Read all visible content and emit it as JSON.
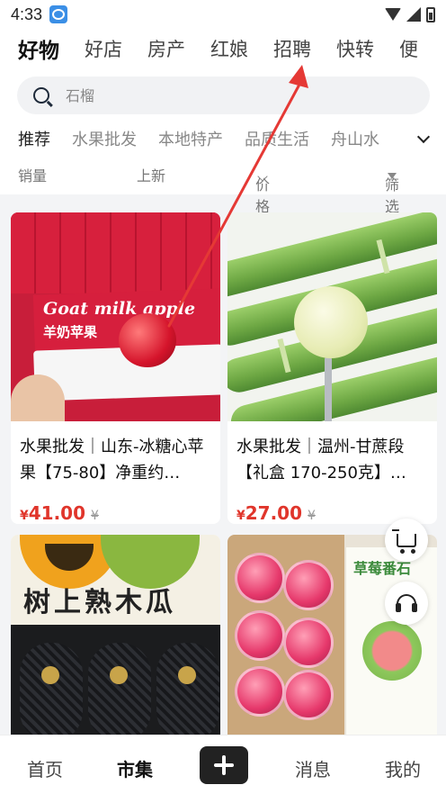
{
  "status_bar": {
    "time": "4:33"
  },
  "top_tabs": [
    "好物",
    "好店",
    "房产",
    "红娘",
    "招聘",
    "快转",
    "便"
  ],
  "search": {
    "placeholder": "石榴"
  },
  "categories": [
    "推荐",
    "水果批发",
    "本地特产",
    "品质生活",
    "舟山水"
  ],
  "sorts": {
    "sales": "销量",
    "new": "上新",
    "price": "价格",
    "filter": "筛选"
  },
  "products": [
    {
      "title": "水果批发｜山东-冰糖心苹果【75-80】净重约…",
      "currency": "¥",
      "price": "41.00",
      "orig_currency": "¥",
      "image_text_1": "Goat milk apple",
      "image_text_2": "羊奶苹果"
    },
    {
      "title": "水果批发｜温州-甘蔗段【礼盒 170-250克】…",
      "currency": "¥",
      "price": "27.00",
      "orig_currency": "¥"
    },
    {
      "image_text_1": "树上熟木瓜"
    },
    {
      "image_text_1": "草莓番石"
    }
  ],
  "bottom_tabs": {
    "home": "首页",
    "market": "市集",
    "messages": "消息",
    "mine": "我的"
  },
  "colors": {
    "price": "#e0352b",
    "annotation_arrow": "#e53935"
  }
}
